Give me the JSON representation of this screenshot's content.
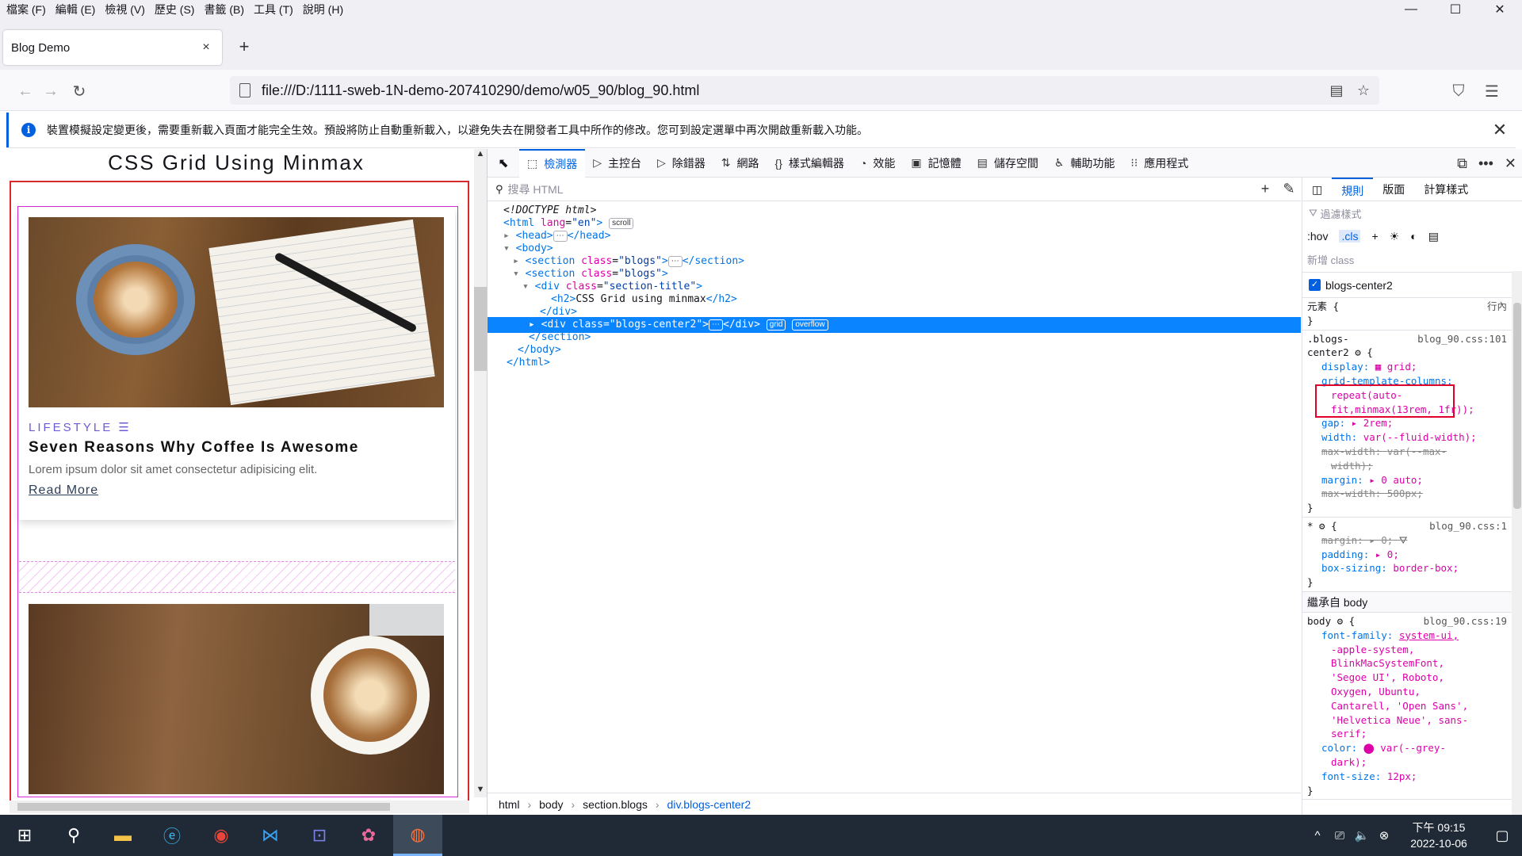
{
  "menubar": {
    "items": [
      "檔案 (F)",
      "編輯 (E)",
      "檢視 (V)",
      "歷史 (S)",
      "書籤 (B)",
      "工具 (T)",
      "說明 (H)"
    ],
    "minimize": "—",
    "maximize": "☐",
    "close": "✕"
  },
  "tab": {
    "title": "Blog Demo",
    "close": "×",
    "new_tab": "+"
  },
  "nav": {
    "back": "←",
    "forward": "→",
    "reload": "↻",
    "url": "file:///D:/1111-sweb-1N-demo-207410290/demo/w05_90/blog_90.html",
    "reader": "▤",
    "bookmark": "☆",
    "pocket": "⛉",
    "menu": "☰"
  },
  "infobar": {
    "icon": "i",
    "text": "裝置模擬設定變更後，需要重新載入頁面才能完全生效。預設將防止自動重新載入，以避免失去在開發者工具中所作的修改。您可到設定選單中再次開啟重新載入功能。",
    "close": "✕"
  },
  "page": {
    "title": "CSS Grid Using Minmax",
    "card": {
      "category": "LIFESTYLE",
      "category_icon": "☰",
      "title": "Seven Reasons Why Coffee Is Awesome",
      "text": "Lorem ipsum dolor sit amet consectetur adipisicing elit.",
      "link": "Read More"
    }
  },
  "devtools": {
    "tabs": [
      {
        "icon": "⬚",
        "label": "檢測器"
      },
      {
        "icon": "▷",
        "label": "主控台"
      },
      {
        "icon": "▷",
        "label": "除錯器"
      },
      {
        "icon": "⇅",
        "label": "網路"
      },
      {
        "icon": "{}",
        "label": "樣式編輯器"
      },
      {
        "icon": "◔",
        "label": "效能"
      },
      {
        "icon": "▣",
        "label": "記憶體"
      },
      {
        "icon": "▤",
        "label": "儲存空間"
      },
      {
        "icon": "♿",
        "label": "輔助功能"
      },
      {
        "icon": "⁝⁝",
        "label": "應用程式"
      }
    ],
    "toolbar_right": [
      "⧉",
      "•••",
      "✕"
    ],
    "search_placeholder": "搜尋 HTML",
    "search_add": "+",
    "search_pick": "✎",
    "markup": {
      "l1": "<!DOCTYPE html>",
      "l2_open": "<html ",
      "l2_attr": "lang",
      "l2_val": "\"en\"",
      "l2_close": ">",
      "l2_badge": "scroll",
      "l3": "<head>",
      "l3_close": "</head>",
      "l4": "<body>",
      "l5_open": "<section ",
      "l5_attr": "class",
      "l5_val": "\"blogs\"",
      "l5_close": "</section>",
      "l6_open": "<section ",
      "l6_attr": "class",
      "l6_val": "\"blogs\"",
      "l7_open": "<div ",
      "l7_attr": "class",
      "l7_val": "\"section-title\"",
      "l8_open": "<h2>",
      "l8_text": "CSS Grid using minmax",
      "l8_close": "</h2>",
      "l9": "</div>",
      "l10_open": "<div ",
      "l10_attr": "class",
      "l10_val": "\"blogs-center2\"",
      "l10_close": "</div>",
      "l10_badge1": "grid",
      "l10_badge2": "overflow",
      "l11": "</section>",
      "l12": "</body>",
      "l13": "</html>",
      "ellipsis": "⋯"
    },
    "breadcrumbs": [
      "html",
      "body",
      "section.blogs",
      "div.blogs-center2"
    ],
    "rules": {
      "tabs": [
        "規則",
        "版面",
        "計算樣式"
      ],
      "filter": "過濾樣式",
      "hov": ":hov",
      "cls": ".cls",
      "tool_icons": [
        "+",
        "☀",
        "◐",
        "▤"
      ],
      "new_class": "新增 class",
      "class_name": "blogs-center2",
      "element": "元素 {",
      "element_inline": "行內",
      "brace_close": "}",
      "r1_selector": ".blogs-",
      "r1_selector2": "center2 ⚙ {",
      "r1_src": "blog_90.css:101",
      "r1_props": [
        {
          "name": "display",
          "value": "▦ grid;"
        },
        {
          "name": "grid-template-columns",
          "value": ""
        },
        {
          "name": "",
          "value": "repeat(auto-"
        },
        {
          "name": "",
          "value": "fit,minmax(13rem, 1fr));"
        },
        {
          "name": "gap",
          "value": "▸ 2rem;"
        },
        {
          "name": "width",
          "value": "var(--fluid-width);"
        },
        {
          "name": "max-width",
          "value": "var(--max-"
        },
        {
          "name": "",
          "value": "width);"
        },
        {
          "name": "margin",
          "value": "▸ 0 auto;"
        },
        {
          "name": "max-width",
          "value": "500px;"
        }
      ],
      "r2_selector": "* ⚙ {",
      "r2_src": "blog_90.css:1",
      "r2_props": [
        {
          "name": "margin",
          "value": "▸ 0;"
        },
        {
          "name": "padding",
          "value": "▸ 0;"
        },
        {
          "name": "box-sizing",
          "value": "border-box;"
        }
      ],
      "inherit": "繼承自 body",
      "r3_selector": "body ⚙ {",
      "r3_src": "blog_90.css:19",
      "r3_font_lines": [
        "system-ui,",
        "-apple-system,",
        "BlinkMacSystemFont,",
        "'Segoe UI', Roboto,",
        "Oxygen, Ubuntu,",
        "Cantarell, 'Open Sans',",
        "'Helvetica Neue', sans-",
        "serif;"
      ],
      "r3_color_lines": [
        "⬤ var(--grey-",
        "dark);"
      ],
      "r3_font_size": "12px;"
    }
  },
  "taskbar": {
    "apps": [
      "⊞",
      "⚲",
      "▬",
      "ⓔ",
      "◉",
      "⋈",
      "⊡",
      "✿",
      "◍"
    ],
    "tray": [
      "^",
      "⎚",
      "🔈",
      "⊗"
    ],
    "time": "下午 09:15",
    "date": "2022-10-06",
    "notif": "▢"
  },
  "colors": {
    "accent": "#0060df",
    "selection": "#0a84ff",
    "grid_outline": "#d72a2a",
    "item_outline": "#d62ad6",
    "category": "#6b5bd6"
  }
}
